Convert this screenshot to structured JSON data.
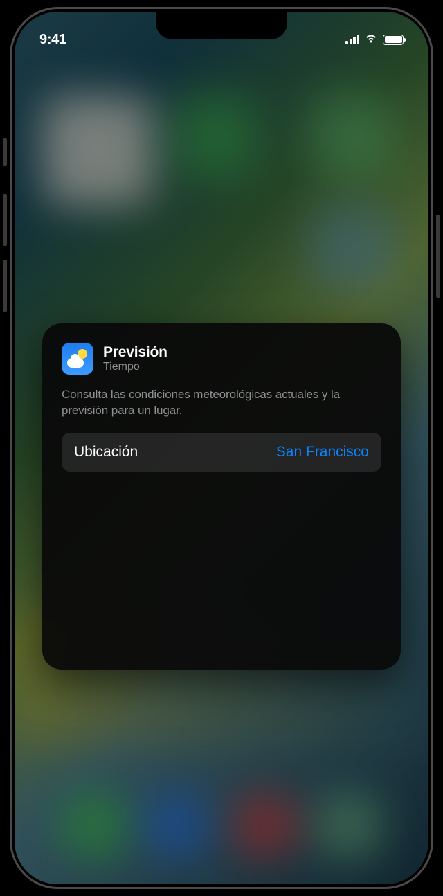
{
  "status_bar": {
    "time": "9:41"
  },
  "widget": {
    "title": "Previsión",
    "subtitle": "Tiempo",
    "description": "Consulta las condiciones meteorológicas actuales y la previsión para un lugar.",
    "location_label": "Ubicación",
    "location_value": "San Francisco"
  }
}
